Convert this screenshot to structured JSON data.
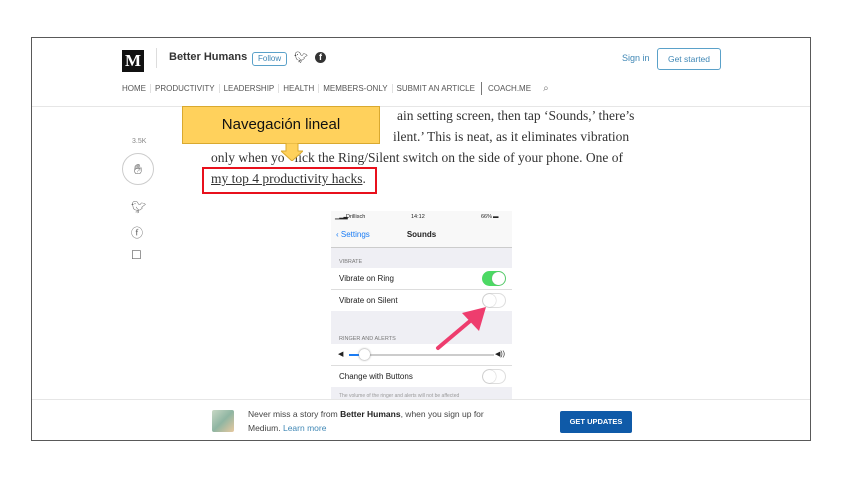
{
  "header": {
    "logo_letter": "M",
    "publication": "Better Humans",
    "follow_label": "Follow",
    "sign_in": "Sign in",
    "get_started": "Get started"
  },
  "nav": {
    "items": [
      "HOME",
      "PRODUCTIVITY",
      "LEADERSHIP",
      "HEALTH",
      "MEMBERS-ONLY",
      "SUBMIT AN ARTICLE",
      "COACH.ME"
    ]
  },
  "rail": {
    "claps": "3.5K"
  },
  "article": {
    "line1": "ain setting screen, then tap ‘Sounds,’ there’s",
    "line2": "ilent.’ This is neat, as it eliminates vibration",
    "line3a": "only when yo",
    "line3b": "lick the Ring/Silent switch on the side of your phone. One of",
    "link": "my top 4 productivity hacks",
    "link_suffix": "."
  },
  "callout": {
    "text": "Navegación lineal",
    "fill": "#ffd15c",
    "box_color": "#e8101c"
  },
  "phone": {
    "carrier": "Drillisch",
    "time": "14:12",
    "battery": "66%",
    "back_label": "Settings",
    "title": "Sounds",
    "section_vibrate": "VIBRATE",
    "vibrate_on_ring": "Vibrate on Ring",
    "vibrate_on_ring_on": true,
    "vibrate_on_silent": "Vibrate on Silent",
    "vibrate_on_silent_on": false,
    "section_ringer": "RINGER AND ALERTS",
    "volume_level": 0.1,
    "change_with_buttons": "Change with Buttons",
    "change_with_buttons_on": false,
    "footnote": "The volume of the ringer and alerts will not be affected"
  },
  "banner": {
    "text_before": "Never miss a story from ",
    "publication": "Better Humans",
    "text_after": ", when you sign up for",
    "text_line2": "Medium. ",
    "learn_more": "Learn more",
    "button": "GET UPDATES"
  },
  "colors": {
    "accent": "#3f87b5",
    "ios_blue": "#1a7cf4",
    "toggle_on": "#4cd964",
    "arrow_pink": "#ee3d6e",
    "button_blue": "#0f5aa8"
  }
}
